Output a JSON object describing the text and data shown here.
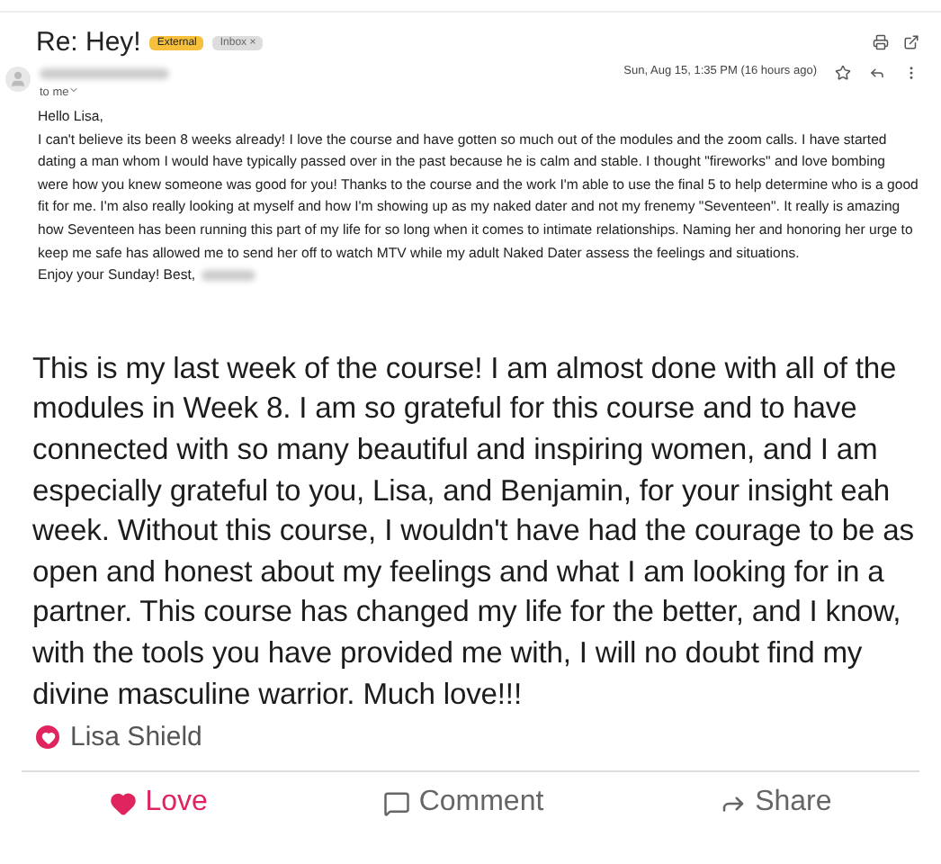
{
  "email": {
    "subject": "Re: Hey!",
    "labels": [
      {
        "text": "External",
        "kind": "external"
      },
      {
        "text": "Inbox",
        "kind": "inbox",
        "removable": "×"
      }
    ],
    "recipient": "to me",
    "date": "Sun, Aug 15, 1:35 PM (16 hours ago)",
    "greeting": "Hello Lisa,",
    "body": "I can't believe its been 8 weeks already!  I love the course and have gotten so much out of the modules and the zoom calls.  I have started dating a man whom I would have typically passed over in the past because he is calm and stable.  I thought \"fireworks\" and love bombing were how you knew someone was good for you!  Thanks to the course and the work I'm able to use the final 5 to help determine who is a good fit for me.  I'm also really looking at myself and how I'm showing up as my naked dater and not my frenemy \"Seventeen\".   It really is amazing how Seventeen has been running this part of my life for so long when it comes to intimate relationships.   Naming her and honoring her urge to keep me safe has allowed me to send her off to watch MTV while my adult Naked Dater assess the feelings and situations.",
    "signoff": "Enjoy your Sunday! Best,"
  },
  "post": {
    "text": "This is my last week of the course! I am almost done with all of the modules in Week 8. I am so grateful for this course and to have connected with so many beautiful and inspiring women, and I am especially grateful to you, Lisa, and Benjamin, for your insight eah week. Without this course, I wouldn't have had the courage to be as open and honest about my feelings and what I am looking for in a partner. This course has changed my life for the better, and I know, with the tools you have provided me with, I will no doubt find my divine masculine warrior. Much love!!!",
    "reactor": "Lisa Shield",
    "actions": [
      {
        "kind": "love",
        "label": "Love",
        "selected": true
      },
      {
        "kind": "comment",
        "label": "Comment",
        "selected": false
      },
      {
        "kind": "share",
        "label": "Share",
        "selected": false
      }
    ]
  }
}
